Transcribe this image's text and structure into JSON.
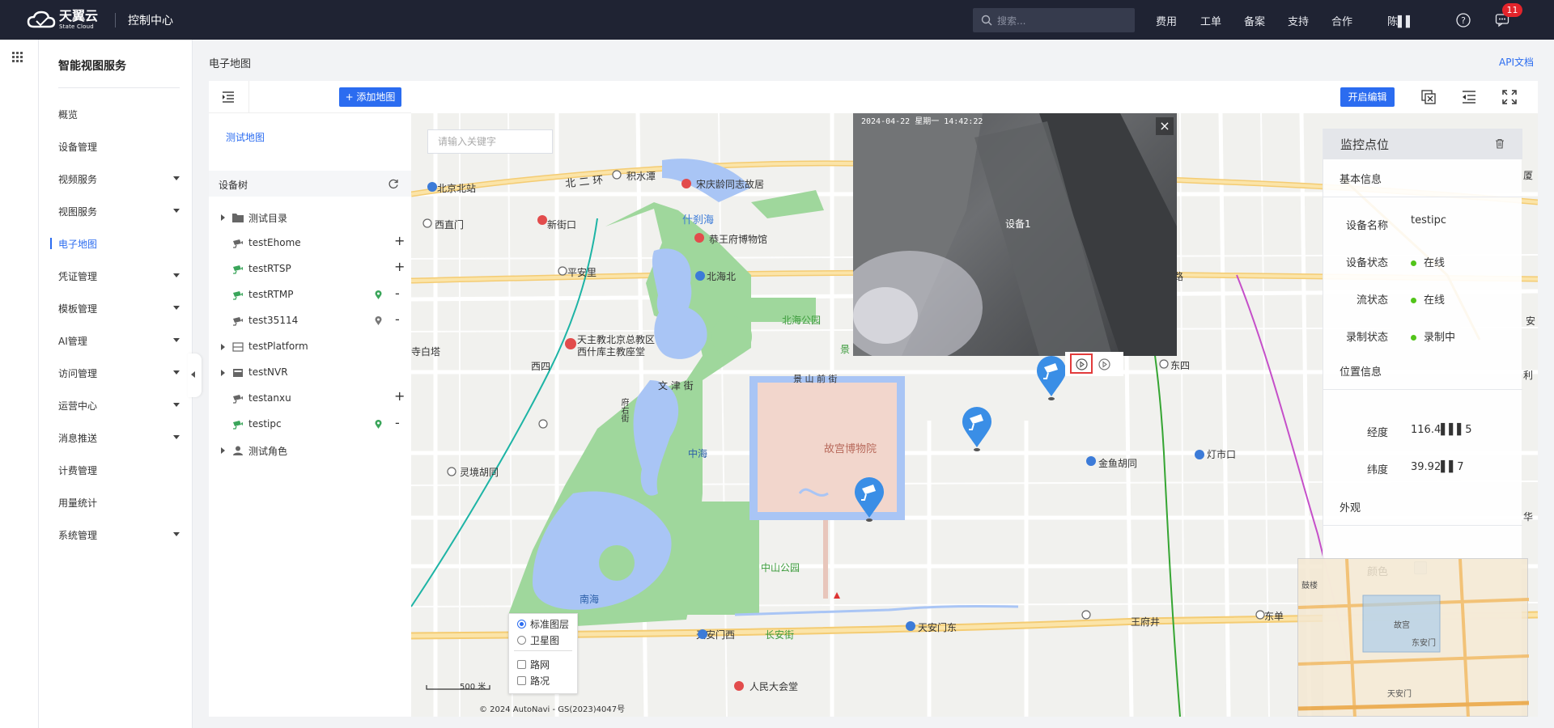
{
  "header": {
    "logo_cn": "天翼云",
    "logo_en": "State Cloud",
    "console": "控制中心",
    "search_placeholder": "搜索...",
    "nav": [
      "费用",
      "工单",
      "备案",
      "支持",
      "合作"
    ],
    "user": "陈▌▌",
    "notifications": "11"
  },
  "sidebar": {
    "title": "智能视图服务",
    "items": [
      {
        "label": "概览",
        "caret": false
      },
      {
        "label": "设备管理",
        "caret": false
      },
      {
        "label": "视频服务",
        "caret": true
      },
      {
        "label": "视图服务",
        "caret": true
      },
      {
        "label": "电子地图",
        "caret": false,
        "active": true
      },
      {
        "label": "凭证管理",
        "caret": true
      },
      {
        "label": "模板管理",
        "caret": true
      },
      {
        "label": "AI管理",
        "caret": true
      },
      {
        "label": "访问管理",
        "caret": true
      },
      {
        "label": "运营中心",
        "caret": true
      },
      {
        "label": "消息推送",
        "caret": true
      },
      {
        "label": "计费管理",
        "caret": false
      },
      {
        "label": "用量统计",
        "caret": false
      },
      {
        "label": "系统管理",
        "caret": true
      }
    ]
  },
  "breadcrumb": "电子地图",
  "api_doc": "API文档",
  "panel": {
    "add_map": "+ 添加地图",
    "map_link": "测试地图",
    "tree_title": "设备树",
    "tree": [
      {
        "label": "测试目录",
        "type": "folder",
        "expand": true,
        "action": ""
      },
      {
        "label": "testEhome",
        "type": "camera",
        "expand": false,
        "action": "+"
      },
      {
        "label": "testRTSP",
        "type": "camera-green",
        "expand": false,
        "action": "+"
      },
      {
        "label": "testRTMP",
        "type": "camera-green",
        "expand": false,
        "action": "-",
        "pin": true
      },
      {
        "label": "test35114",
        "type": "camera",
        "expand": false,
        "action": "-",
        "pin": true
      },
      {
        "label": "testPlatform",
        "type": "platform",
        "expand": true,
        "action": ""
      },
      {
        "label": "testNVR",
        "type": "nvr",
        "expand": true,
        "action": ""
      },
      {
        "label": "testanxu",
        "type": "camera",
        "expand": false,
        "action": "+"
      },
      {
        "label": "testipc",
        "type": "camera-green",
        "expand": false,
        "action": "-",
        "pin": true
      },
      {
        "label": "测试角色",
        "type": "role",
        "expand": true,
        "action": ""
      }
    ]
  },
  "map": {
    "open_edit": "开启编辑",
    "keyword_placeholder": "请输入关键字",
    "video": {
      "timestamp": "2024-04-22 星期一 14:42:22",
      "device": "设备1"
    },
    "labels": [
      {
        "t": "北京北站"
      },
      {
        "t": "西直门"
      },
      {
        "t": "新街口"
      },
      {
        "t": "积水潭"
      },
      {
        "t": "北 二 环"
      },
      {
        "t": "宋庆龄同志故居"
      },
      {
        "t": "什刹海"
      },
      {
        "t": "恭王府博物馆"
      },
      {
        "t": "平安里"
      },
      {
        "t": "北海北"
      },
      {
        "t": "北海公园"
      },
      {
        "t": "天主教北京总教区"
      },
      {
        "t": "西什库主教座堂"
      },
      {
        "t": "西四"
      },
      {
        "t": "文 津 街"
      },
      {
        "t": "景 山 前 街"
      },
      {
        "t": "府右街"
      },
      {
        "t": "中海"
      },
      {
        "t": "故宫博物院"
      },
      {
        "t": "灵境胡同"
      },
      {
        "t": "中山公园"
      },
      {
        "t": "南海"
      },
      {
        "t": "天安门西"
      },
      {
        "t": "长安街"
      },
      {
        "t": "天安门东"
      },
      {
        "t": "人民大会堂"
      },
      {
        "t": "金鱼胡同"
      },
      {
        "t": "灯市口"
      },
      {
        "t": "东四"
      },
      {
        "t": "王府井"
      },
      {
        "t": "东单"
      },
      {
        "t": "寺白塔"
      },
      {
        "t": "景"
      },
      {
        "t": "路"
      },
      {
        "t": "厦"
      },
      {
        "t": "利"
      },
      {
        "t": "华"
      },
      {
        "t": "安"
      }
    ],
    "layers": {
      "standard": "标准图层",
      "satellite": "卫星图",
      "road": "路网",
      "traffic": "路况"
    },
    "scale": "500 米",
    "copyright": "© 2024 AutoNavi - GS(2023)4047号"
  },
  "info": {
    "title": "监控点位",
    "basic": "基本信息",
    "device_name_k": "设备名称",
    "device_name_v": "testipc",
    "device_status_k": "设备状态",
    "device_status_v": "在线",
    "stream_status_k": "流状态",
    "stream_status_v": "在线",
    "record_status_k": "录制状态",
    "record_status_v": "录制中",
    "position": "位置信息",
    "lng_k": "经度",
    "lng_v": "116.4▌▌▌5",
    "lat_k": "纬度",
    "lat_v": "39.92▌▌7",
    "appearance": "外观",
    "color_k": "颜色",
    "minimap": [
      "鼓楼",
      "故宫",
      "东安门",
      "天安门"
    ]
  },
  "colors": {
    "accent": "#2b6cf0",
    "online": "#52c41a",
    "topbar": "#1f2333",
    "water": "#a9c5f5",
    "park": "#9fd79c",
    "palace": "#f2d6cc"
  }
}
